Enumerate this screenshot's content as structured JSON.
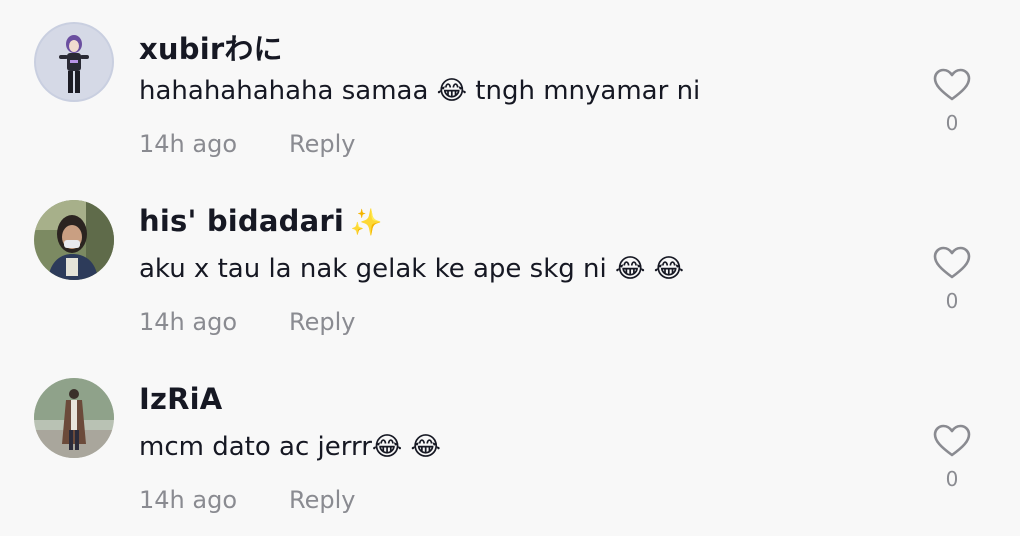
{
  "comments": [
    {
      "username": "xubirわに",
      "text": "hahahahahaha samaa 😂  tngh mnyamar ni",
      "time": "14h ago",
      "reply_label": "Reply",
      "like_count": "0",
      "avatar_icon": "avatar-anime-figure"
    },
    {
      "username": "his' bidadari",
      "username_suffix": "✨",
      "text": "aku x tau la nak gelak ke ape skg ni 😂 😂",
      "time": "14h ago",
      "reply_label": "Reply",
      "like_count": "0",
      "avatar_icon": "avatar-person-mask"
    },
    {
      "username": "IzRiA",
      "text": "mcm dato ac jerrr😂 😂",
      "time": "14h ago",
      "reply_label": "Reply",
      "like_count": "0",
      "avatar_icon": "avatar-person-standing"
    }
  ],
  "colors": {
    "background": "#f8f8f8",
    "text": "#161823",
    "secondary": "#8a8b91"
  }
}
